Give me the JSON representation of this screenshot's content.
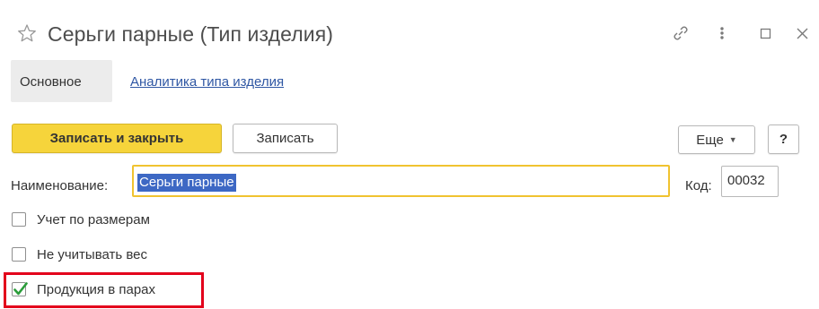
{
  "header": {
    "title": "Серьги парные (Тип изделия)",
    "icons": [
      "star-icon",
      "link-icon",
      "more-vertical-icon",
      "maximize-icon",
      "close-icon"
    ]
  },
  "tabs": {
    "main_label": "Основное",
    "analytics_label": "Аналитика типа изделия"
  },
  "toolbar": {
    "save_close_label": "Записать и закрыть",
    "save_label": "Записать",
    "more_label": "Еще",
    "help_label": "?"
  },
  "form": {
    "name_label": "Наименование:",
    "name_value": "Серьги парные",
    "code_label": "Код:",
    "code_value": "00032"
  },
  "checkboxes": [
    {
      "label": "Учет по размерам",
      "checked": false
    },
    {
      "label": "Не учитывать вес",
      "checked": false
    },
    {
      "label": "Продукция в парах",
      "checked": true
    }
  ],
  "colors": {
    "primary_button": "#f6d43b",
    "focus_border": "#f0c330",
    "selection": "#3d68c4",
    "highlight_frame": "#e3001b",
    "link": "#2f57a4",
    "check": "#2a9d3a"
  }
}
